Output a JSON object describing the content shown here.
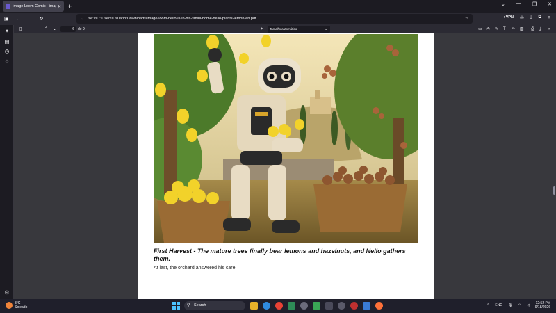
{
  "browser": {
    "tab_title": "Image Loom Comic - image-lo",
    "url": "file:///C:/Users/Usuario/Downloads/image-loom-nello-is-in-his-small-home-nello-plants-lemon-en.pdf",
    "vpn_label": "VPN"
  },
  "pdf_toolbar": {
    "page_number": "6",
    "page_total": "de 9",
    "zoom": "Tamaño automático"
  },
  "document": {
    "caption_title": "First Harvest - The mature trees finally bear lemons and hazelnuts, and Nello gathers them.",
    "caption_body": "At last, the orchard answered his care."
  },
  "taskbar": {
    "weather_temp": "8°C",
    "weather_desc": "Soleado",
    "search_placeholder": "Search",
    "lang": "ENG",
    "time": "12:52 PM",
    "date": "9/18/2026"
  },
  "colors": {
    "accent": "#4cc2ff",
    "toolbar": "#2b2a33",
    "viewer_bg": "#38383d"
  }
}
